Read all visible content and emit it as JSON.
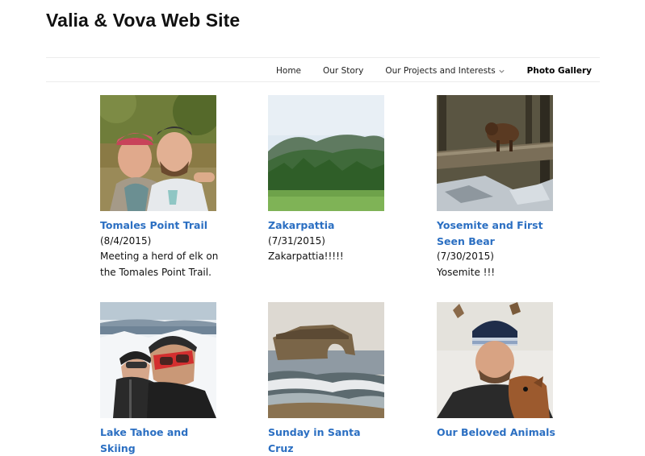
{
  "site": {
    "title": "Valia & Vova Web Site"
  },
  "nav": {
    "items": [
      {
        "label": "Home"
      },
      {
        "label": "Our Story"
      },
      {
        "label": "Our Projects and Interests"
      },
      {
        "label": "Photo Gallery"
      }
    ]
  },
  "gallery": {
    "cards": [
      {
        "title": "Tomales Point Trail",
        "date": "(8/4/2015)",
        "description": "Meeting a herd of elk on the Tomales Point Trail."
      },
      {
        "title": "Zakarpattia",
        "date": "(7/31/2015)",
        "description": "Zakarpattia!!!!!"
      },
      {
        "title": "Yosemite and First Seen Bear",
        "date": "(7/30/2015)",
        "description": "Yosemite !!!"
      },
      {
        "title": "Lake Tahoe and Skiing"
      },
      {
        "title": "Sunday in Santa Cruz"
      },
      {
        "title": "Our Beloved Animals"
      }
    ]
  },
  "colors": {
    "link": "#2b6fc2",
    "text": "#111111",
    "rule": "#ececec"
  }
}
